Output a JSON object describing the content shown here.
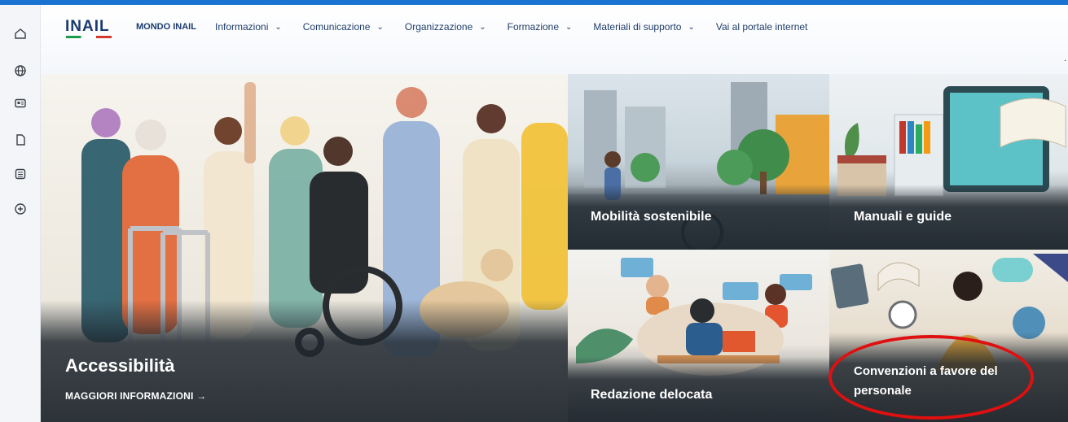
{
  "header": {
    "logo_text": "INAIL",
    "brand": "MONDO INAIL",
    "nav": [
      {
        "label": "Informazioni",
        "has_menu": true
      },
      {
        "label": "Comunicazione",
        "has_menu": true
      },
      {
        "label": "Organizzazione",
        "has_menu": true
      },
      {
        "label": "Formazione",
        "has_menu": true
      },
      {
        "label": "Materiali di supporto",
        "has_menu": true
      },
      {
        "label": "Vai al portale internet",
        "has_menu": false
      }
    ]
  },
  "sidebar_icons": [
    "home-icon",
    "globe-icon",
    "news-icon",
    "document-icon",
    "list-icon",
    "add-circle-icon"
  ],
  "tiles": {
    "main": {
      "title": "Accessibilità",
      "link": "MAGGIORI INFORMAZIONI",
      "link_arrow": "→"
    },
    "mobility": {
      "title": "Mobilità sostenibile"
    },
    "manuals": {
      "title": "Manuali e guide"
    },
    "redazione": {
      "title": "Redazione delocata"
    },
    "convenzioni": {
      "title": "Convenzioni a favore del personale"
    }
  },
  "colors": {
    "accent": "#1a73d1",
    "highlight": "#e01010",
    "nav_text": "#1f3d6b"
  }
}
